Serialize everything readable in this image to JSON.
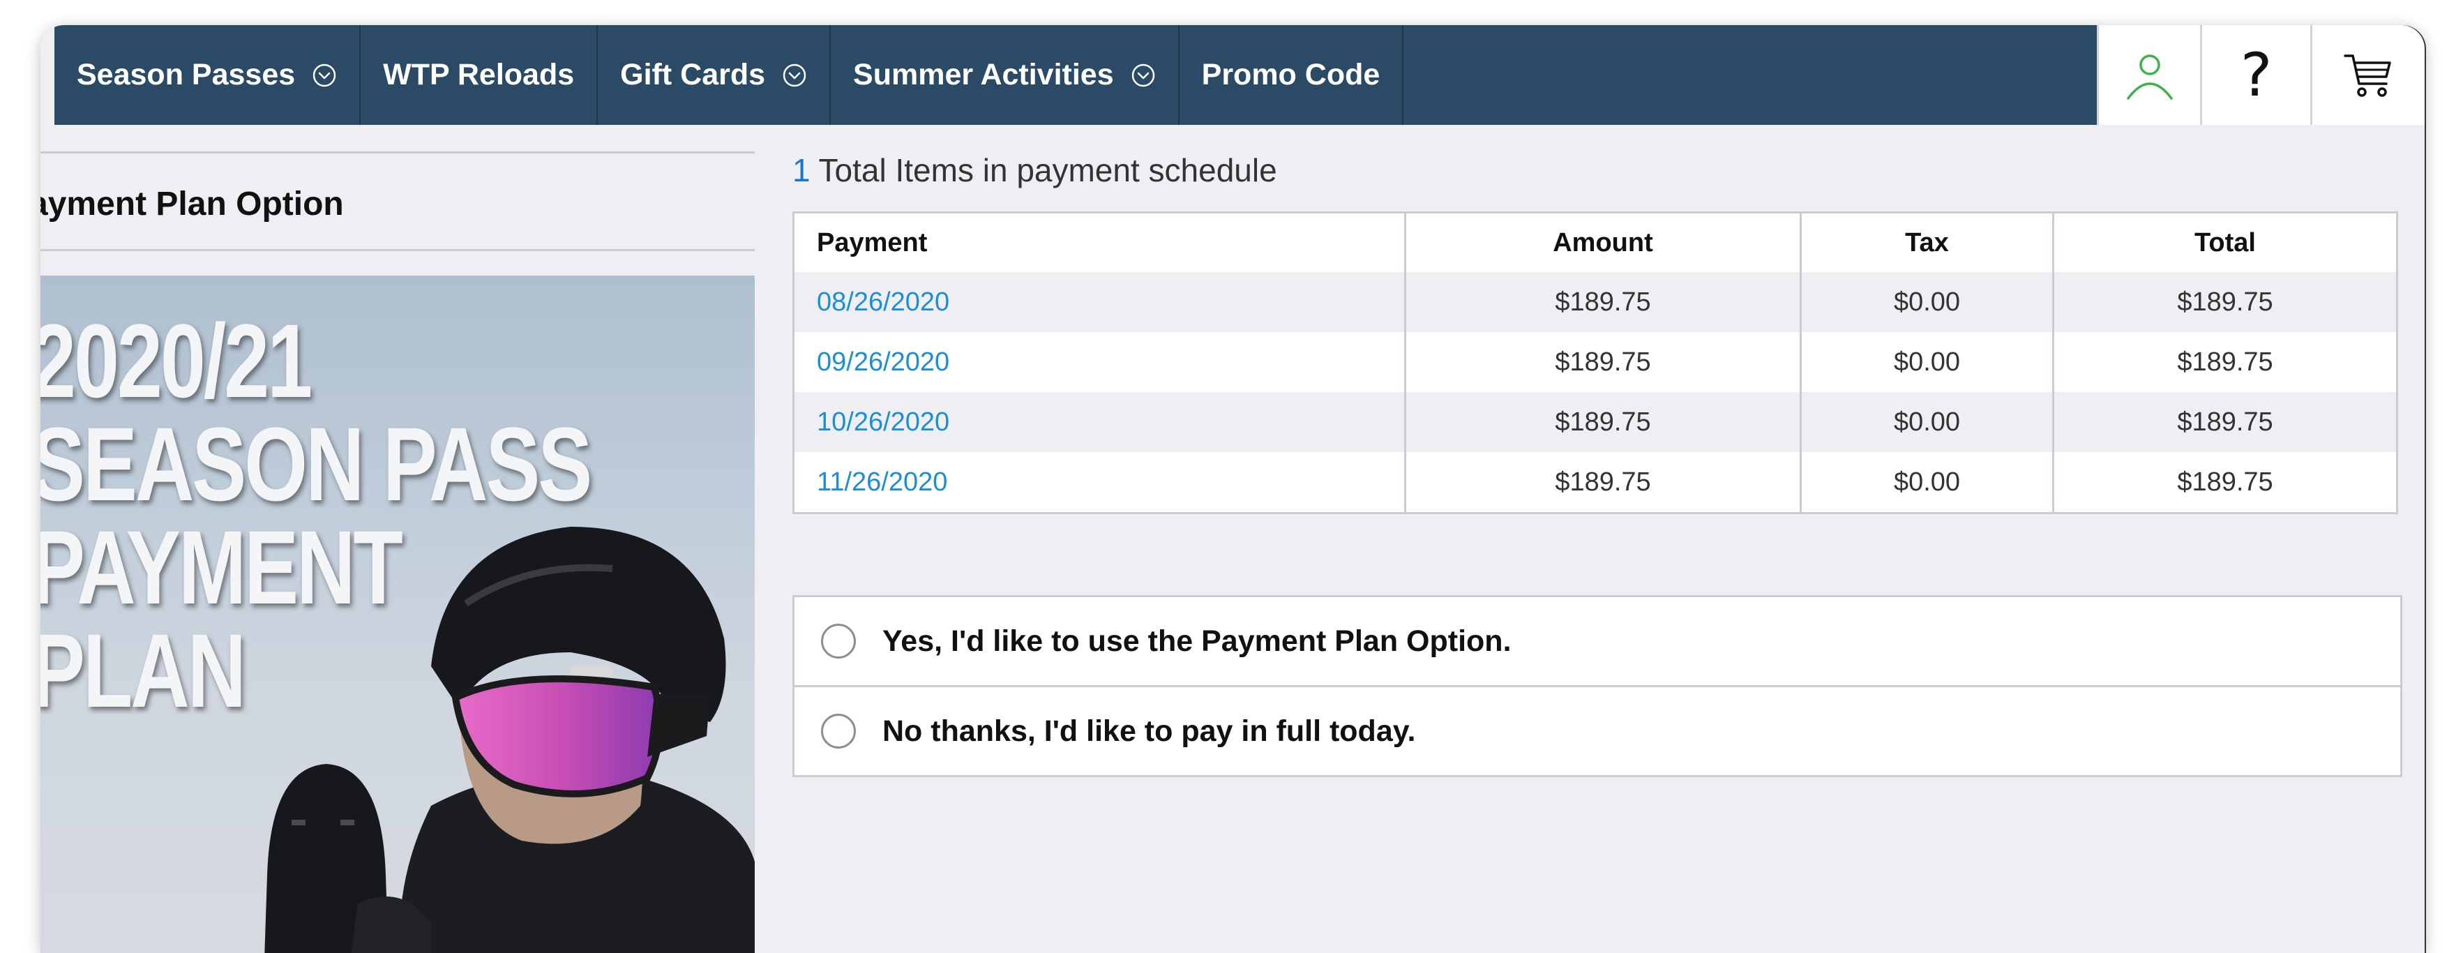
{
  "nav": {
    "items": [
      {
        "label": "Season Passes",
        "has_dropdown": true
      },
      {
        "label": "WTP Reloads",
        "has_dropdown": false
      },
      {
        "label": "Gift Cards",
        "has_dropdown": true
      },
      {
        "label": "Summer Activities",
        "has_dropdown": true
      },
      {
        "label": "Promo Code",
        "has_dropdown": false
      }
    ],
    "icons": {
      "account": "user-icon",
      "help": "question-icon",
      "cart": "cart-icon"
    },
    "help_glyph": "?",
    "colors": {
      "bar": "#2b4a66",
      "account_icon": "#3bb24a"
    }
  },
  "left": {
    "section_title": "ayment Plan Option",
    "promo_lines": [
      "2020/21",
      "SEASON PASS",
      "PAYMENT",
      "PLAN"
    ]
  },
  "summary": {
    "count": "1",
    "text": "Total Items in payment schedule"
  },
  "schedule": {
    "headers": {
      "payment": "Payment",
      "amount": "Amount",
      "tax": "Tax",
      "total": "Total"
    },
    "rows": [
      {
        "date": "08/26/2020",
        "amount": "$189.75",
        "tax": "$0.00",
        "total": "$189.75"
      },
      {
        "date": "09/26/2020",
        "amount": "$189.75",
        "tax": "$0.00",
        "total": "$189.75"
      },
      {
        "date": "10/26/2020",
        "amount": "$189.75",
        "tax": "$0.00",
        "total": "$189.75"
      },
      {
        "date": "11/26/2020",
        "amount": "$189.75",
        "tax": "$0.00",
        "total": "$189.75"
      }
    ],
    "colors": {
      "link": "#1a8fd6"
    }
  },
  "options": [
    {
      "label": "Yes, I'd like to use the Payment Plan Option.",
      "selected": false
    },
    {
      "label": "No thanks, I'd like to pay in full today.",
      "selected": false
    }
  ]
}
